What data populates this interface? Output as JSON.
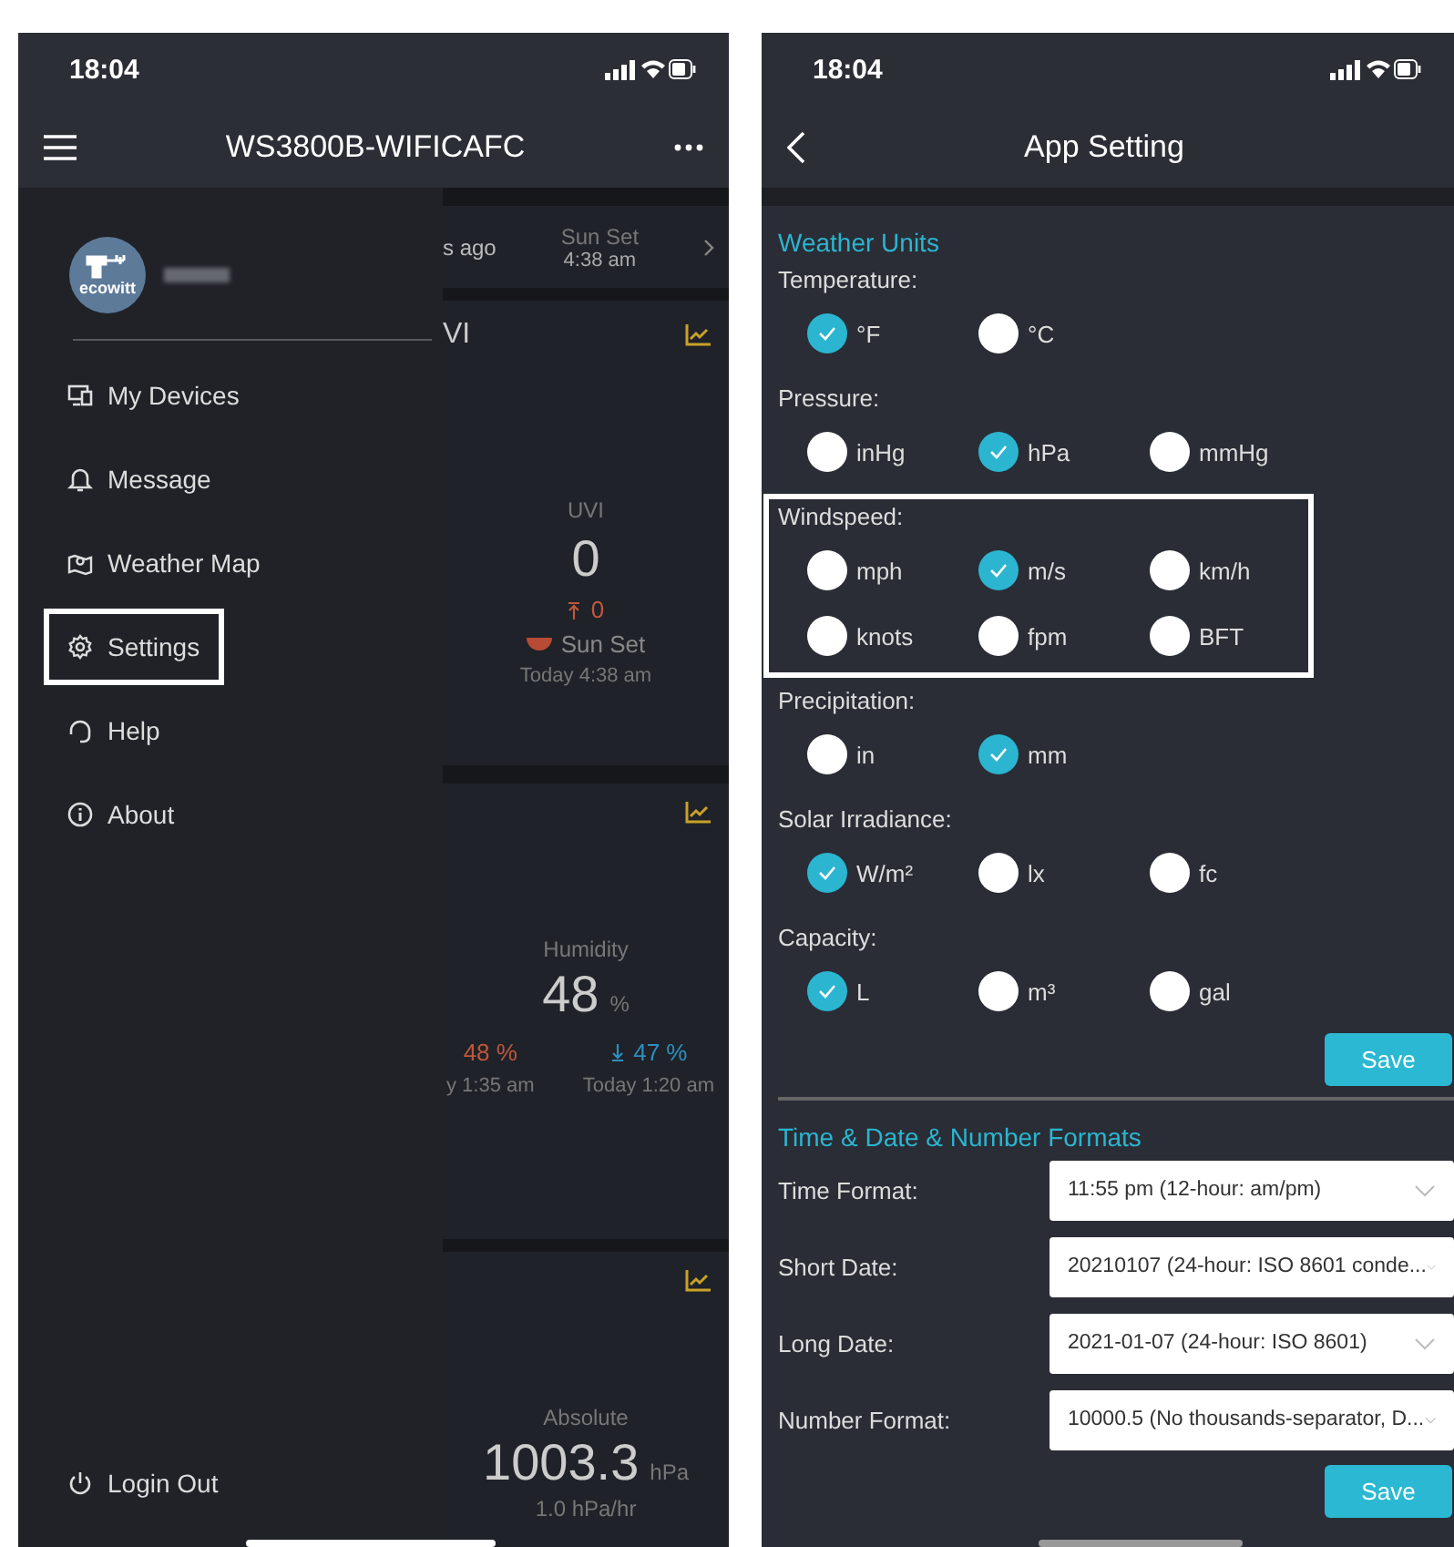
{
  "left_phone": {
    "status_bar": {
      "time": "18:04"
    },
    "header": {
      "title": "WS3800B-WIFICAFC"
    },
    "drawer": {
      "logo_text": "ecowitt",
      "items": [
        {
          "label": "My Devices",
          "highlighted": false
        },
        {
          "label": "Message",
          "highlighted": false
        },
        {
          "label": "Weather Map",
          "highlighted": false
        },
        {
          "label": "Settings",
          "highlighted": true
        },
        {
          "label": "Help",
          "highlighted": false
        },
        {
          "label": "About",
          "highlighted": false
        }
      ],
      "footer_item": {
        "label": "Login Out"
      }
    },
    "sun_card": {
      "ago": "s ago",
      "label": "Sun Set",
      "time": "4:38 am"
    },
    "uvi_card": {
      "title": "VI",
      "label": "UVI",
      "value": "0",
      "max": "0",
      "sun_label": "Sun Set",
      "sun_time": "Today 4:38 am"
    },
    "humidity_card": {
      "label": "Humidity",
      "value": "48",
      "unit": "%",
      "max": "48 %",
      "min": "47 %",
      "max_time": "y 1:35 am",
      "min_time": "Today 1:20 am"
    },
    "pressure_card": {
      "label": "Absolute",
      "value": "1003.3",
      "unit": "hPa",
      "rate": "1.0 hPa/hr"
    }
  },
  "right_phone": {
    "status_bar": {
      "time": "18:04"
    },
    "header": {
      "title": "App Setting"
    },
    "units": {
      "title": "Weather Units",
      "groups": [
        {
          "label": "Temperature:",
          "highlighted": false,
          "options": [
            {
              "label": "°F",
              "selected": true
            },
            {
              "label": "°C",
              "selected": false
            }
          ]
        },
        {
          "label": "Pressure:",
          "highlighted": false,
          "options": [
            {
              "label": "inHg",
              "selected": false
            },
            {
              "label": "hPa",
              "selected": true
            },
            {
              "label": "mmHg",
              "selected": false
            }
          ]
        },
        {
          "label": "Windspeed:",
          "highlighted": true,
          "options": [
            {
              "label": "mph",
              "selected": false
            },
            {
              "label": "m/s",
              "selected": true
            },
            {
              "label": "km/h",
              "selected": false
            },
            {
              "label": "knots",
              "selected": false
            },
            {
              "label": "fpm",
              "selected": false
            },
            {
              "label": "BFT",
              "selected": false
            }
          ]
        },
        {
          "label": "Precipitation:",
          "highlighted": false,
          "options": [
            {
              "label": "in",
              "selected": false
            },
            {
              "label": "mm",
              "selected": true
            }
          ]
        },
        {
          "label": "Solar Irradiance:",
          "highlighted": false,
          "options": [
            {
              "label": "W/m²",
              "selected": true
            },
            {
              "label": "lx",
              "selected": false
            },
            {
              "label": "fc",
              "selected": false
            }
          ]
        },
        {
          "label": "Capacity:",
          "highlighted": false,
          "options": [
            {
              "label": "L",
              "selected": true
            },
            {
              "label": "m³",
              "selected": false
            },
            {
              "label": "gal",
              "selected": false
            }
          ]
        }
      ],
      "save": "Save"
    },
    "formats": {
      "title": "Time & Date & Number Formats",
      "rows": [
        {
          "label": "Time Format:",
          "value": "11:55 pm (12-hour: am/pm)"
        },
        {
          "label": "Short Date:",
          "value": "20210107 (24-hour: ISO 8601 conde..."
        },
        {
          "label": "Long Date:",
          "value": "2021-01-07 (24-hour: ISO 8601)"
        },
        {
          "label": "Number Format:",
          "value": "10000.5 (No thousands-separator, D..."
        }
      ],
      "save": "Save"
    }
  }
}
